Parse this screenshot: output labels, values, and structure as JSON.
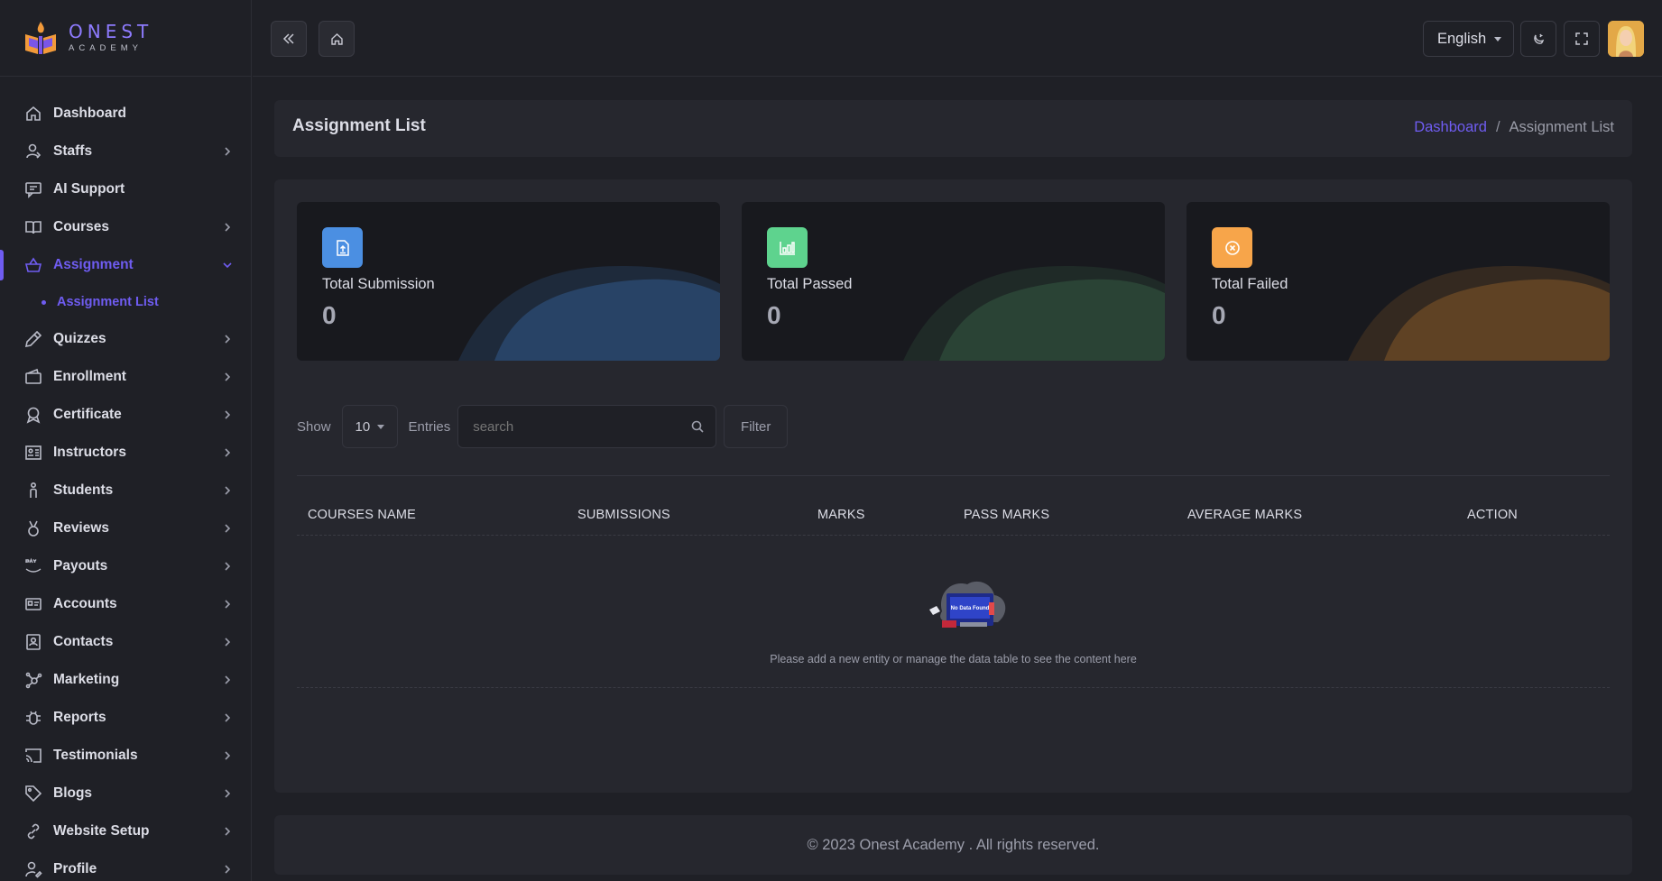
{
  "brand": {
    "name": "ONEST",
    "subtitle": "ACADEMY"
  },
  "sidebar": {
    "items": [
      {
        "label": "Dashboard",
        "icon": "home-icon",
        "has_children": false
      },
      {
        "label": "Staffs",
        "icon": "user-icon",
        "has_children": true
      },
      {
        "label": "AI Support",
        "icon": "chat-icon",
        "has_children": false
      },
      {
        "label": "Courses",
        "icon": "book-icon",
        "has_children": true
      },
      {
        "label": "Assignment",
        "icon": "basket-icon",
        "has_children": true,
        "active": true,
        "expanded": true
      },
      {
        "label": "Quizzes",
        "icon": "pen-icon",
        "has_children": true
      },
      {
        "label": "Enrollment",
        "icon": "wallet-icon",
        "has_children": true
      },
      {
        "label": "Certificate",
        "icon": "award-icon",
        "has_children": true
      },
      {
        "label": "Instructors",
        "icon": "id-board-icon",
        "has_children": true
      },
      {
        "label": "Students",
        "icon": "person-icon",
        "has_children": true
      },
      {
        "label": "Reviews",
        "icon": "medal-icon",
        "has_children": true
      },
      {
        "label": "Payouts",
        "icon": "pay-icon",
        "has_children": true
      },
      {
        "label": "Accounts",
        "icon": "card-icon",
        "has_children": true
      },
      {
        "label": "Contacts",
        "icon": "contact-icon",
        "has_children": true
      },
      {
        "label": "Marketing",
        "icon": "hub-icon",
        "has_children": true
      },
      {
        "label": "Reports",
        "icon": "bug-icon",
        "has_children": true
      },
      {
        "label": "Testimonials",
        "icon": "cast-icon",
        "has_children": true
      },
      {
        "label": "Blogs",
        "icon": "tag-icon",
        "has_children": true
      },
      {
        "label": "Website Setup",
        "icon": "link-icon",
        "has_children": true
      },
      {
        "label": "Profile",
        "icon": "profile-icon",
        "has_children": true
      }
    ],
    "sub_items": {
      "assignment": [
        {
          "label": "Assignment List",
          "active": true
        }
      ]
    }
  },
  "header": {
    "language": "English"
  },
  "page": {
    "title": "Assignment List",
    "breadcrumb": {
      "home": "Dashboard",
      "separator": "/",
      "current": "Assignment List"
    }
  },
  "stats": [
    {
      "label": "Total Submission",
      "value": "0",
      "icon": "file-upload-icon",
      "color": "#4b8fe2",
      "wave": "#2a4a72"
    },
    {
      "label": "Total Passed",
      "value": "0",
      "icon": "bar-chart-icon",
      "color": "#5ed38e",
      "wave": "#2d4a3a"
    },
    {
      "label": "Total Failed",
      "value": "0",
      "icon": "x-circle-icon",
      "color": "#f7a54a",
      "wave": "#6a4826"
    }
  ],
  "table_controls": {
    "show_label": "Show",
    "page_size": "10",
    "entries_label": "Entries",
    "search_placeholder": "search",
    "filter_label": "Filter"
  },
  "table": {
    "columns": [
      "COURSES NAME",
      "SUBMISSIONS",
      "MARKS",
      "PASS MARKS",
      "AVERAGE MARKS",
      "ACTION"
    ],
    "rows": [],
    "empty_message": "Please add a new entity or manage the data table to see the content here",
    "empty_illustration_text": "No Data Found"
  },
  "footer": {
    "text": "© 2023 Onest Academy . All rights reserved."
  },
  "colors": {
    "accent": "#6f5cf1",
    "background": "#1f2026",
    "card": "#26272e"
  }
}
